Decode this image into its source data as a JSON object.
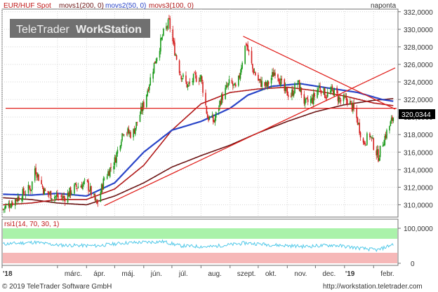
{
  "header": {
    "symbol": "EUR/HUF Spot",
    "indicators": [
      "movs1(200, 0)",
      "movs2(50, 0)",
      "movs3(100, 0)"
    ],
    "period": "naponta",
    "watermark_brand": "TeleTrader",
    "watermark_product": "WorkStation"
  },
  "footer": {
    "copyright": "© 2019 TeleTrader Software GmbH",
    "url": "http://workstation.teletrader.com"
  },
  "colors": {
    "candle_up": "#1a9a1a",
    "candle_down": "#d42020",
    "movs1": "#6b1414",
    "movs2": "#2a45c8",
    "movs3": "#b01818",
    "trendline": "#e0201c",
    "rsi_line": "#4fc8e8",
    "rsi_upper_zone": "#aaf2aa",
    "rsi_lower_zone": "#f6b8b8",
    "grid": "#d6d6d6",
    "frame": "#707070",
    "header_text": "#c01818",
    "price_label_bg": "#000000"
  },
  "chart_data": {
    "type": "candlestick",
    "x_ticks": [
      "'18",
      "márc.",
      "ápr.",
      "máj.",
      "jún.",
      "júl.",
      "aug.",
      "szept.",
      "okt.",
      "nov.",
      "dec.",
      "'19",
      "febr."
    ],
    "y_ticks": [
      "310,0000",
      "312,0000",
      "314,0000",
      "316,0000",
      "318,0000",
      "320,0000",
      "322,0000",
      "324,0000",
      "326,0000",
      "328,0000",
      "330,0000",
      "332,0000"
    ],
    "ylim": [
      308.6,
      332.3
    ],
    "last_price_label": "320,0344",
    "last_price": 320.03,
    "horizontal_line": 321.0,
    "close_anchors": [
      [
        "2018-01-02",
        309.5
      ],
      [
        "2018-01-20",
        311.0
      ],
      [
        "2018-02-01",
        312.0
      ],
      [
        "2018-02-05",
        314.2
      ],
      [
        "2018-02-15",
        311.5
      ],
      [
        "2018-02-25",
        311.0
      ],
      [
        "2018-03-08",
        310.8
      ],
      [
        "2018-03-20",
        312.0
      ],
      [
        "2018-04-01",
        312.5
      ],
      [
        "2018-04-12",
        310.0
      ],
      [
        "2018-04-20",
        313.0
      ],
      [
        "2018-05-01",
        315.0
      ],
      [
        "2018-05-10",
        318.5
      ],
      [
        "2018-05-20",
        318.0
      ],
      [
        "2018-06-01",
        321.5
      ],
      [
        "2018-06-12",
        326.0
      ],
      [
        "2018-06-22",
        329.5
      ],
      [
        "2018-06-28",
        330.8
      ],
      [
        "2018-07-03",
        328.0
      ],
      [
        "2018-07-10",
        325.0
      ],
      [
        "2018-07-18",
        323.5
      ],
      [
        "2018-07-25",
        324.5
      ],
      [
        "2018-08-01",
        324.5
      ],
      [
        "2018-08-08",
        320.0
      ],
      [
        "2018-08-15",
        319.5
      ],
      [
        "2018-08-22",
        322.0
      ],
      [
        "2018-09-01",
        324.0
      ],
      [
        "2018-09-08",
        323.0
      ],
      [
        "2018-09-14",
        326.5
      ],
      [
        "2018-09-18",
        328.5
      ],
      [
        "2018-09-25",
        325.5
      ],
      [
        "2018-10-02",
        324.0
      ],
      [
        "2018-10-10",
        323.5
      ],
      [
        "2018-10-20",
        325.5
      ],
      [
        "2018-10-28",
        323.0
      ],
      [
        "2018-11-05",
        322.5
      ],
      [
        "2018-11-12",
        324.0
      ],
      [
        "2018-11-20",
        321.5
      ],
      [
        "2018-11-28",
        322.0
      ],
      [
        "2018-12-05",
        323.5
      ],
      [
        "2018-12-12",
        322.5
      ],
      [
        "2018-12-20",
        323.0
      ],
      [
        "2018-12-28",
        321.8
      ],
      [
        "2019-01-04",
        322.0
      ],
      [
        "2019-01-10",
        321.0
      ],
      [
        "2019-01-15",
        319.5
      ],
      [
        "2019-01-21",
        317.0
      ],
      [
        "2019-01-28",
        318.0
      ],
      [
        "2019-02-02",
        316.5
      ],
      [
        "2019-02-06",
        315.5
      ],
      [
        "2019-02-12",
        317.5
      ],
      [
        "2019-02-18",
        319.0
      ],
      [
        "2019-02-22",
        320.0
      ]
    ],
    "movs1_anchors": [
      [
        "2018-01-02",
        310.8
      ],
      [
        "2018-02-01",
        310.6
      ],
      [
        "2018-03-01",
        310.2
      ],
      [
        "2018-04-01",
        310.0
      ],
      [
        "2018-05-01",
        311.0
      ],
      [
        "2018-06-01",
        312.5
      ],
      [
        "2018-07-01",
        314.3
      ],
      [
        "2018-08-01",
        315.6
      ],
      [
        "2018-09-01",
        316.8
      ],
      [
        "2018-10-01",
        318.2
      ],
      [
        "2018-11-01",
        319.5
      ],
      [
        "2018-12-01",
        320.6
      ],
      [
        "2019-01-01",
        321.4
      ],
      [
        "2019-02-01",
        321.9
      ],
      [
        "2019-02-22",
        322.1
      ]
    ],
    "movs2_anchors": [
      [
        "2018-01-02",
        311.2
      ],
      [
        "2018-02-01",
        311.1
      ],
      [
        "2018-03-01",
        311.3
      ],
      [
        "2018-04-01",
        311.0
      ],
      [
        "2018-05-01",
        312.5
      ],
      [
        "2018-06-01",
        316.0
      ],
      [
        "2018-07-01",
        318.5
      ],
      [
        "2018-08-01",
        319.5
      ],
      [
        "2018-09-01",
        321.0
      ],
      [
        "2018-09-20",
        322.5
      ],
      [
        "2018-10-15",
        323.5
      ],
      [
        "2018-11-15",
        323.8
      ],
      [
        "2018-12-15",
        323.3
      ],
      [
        "2019-01-15",
        322.8
      ],
      [
        "2019-02-10",
        322.0
      ],
      [
        "2019-02-22",
        321.8
      ]
    ],
    "movs3_anchors": [
      [
        "2018-01-02",
        310.0
      ],
      [
        "2018-02-01",
        310.2
      ],
      [
        "2018-03-01",
        310.6
      ],
      [
        "2018-04-01",
        310.6
      ],
      [
        "2018-05-01",
        311.8
      ],
      [
        "2018-06-01",
        314.5
      ],
      [
        "2018-07-01",
        318.5
      ],
      [
        "2018-08-01",
        321.5
      ],
      [
        "2018-09-01",
        322.8
      ],
      [
        "2018-10-01",
        323.2
      ],
      [
        "2018-11-01",
        323.4
      ],
      [
        "2018-12-01",
        323.0
      ],
      [
        "2019-01-01",
        322.4
      ],
      [
        "2019-02-01",
        321.6
      ],
      [
        "2019-02-22",
        321.3
      ]
    ],
    "trendlines": [
      [
        [
          "2018-09-15",
          329.2
        ],
        [
          "2019-02-24",
          320.9
        ]
      ],
      [
        [
          "2018-04-20",
          309.9
        ],
        [
          "2019-02-24",
          325.6
        ]
      ]
    ],
    "rsi": {
      "label": "rsi1(14, 70, 30, 1)",
      "ylim": [
        0,
        100
      ],
      "upper": 70,
      "lower": 30,
      "y_ticks": [
        "100,0000",
        "0"
      ],
      "anchors": [
        [
          "2018-01-02",
          55
        ],
        [
          "2018-02-05",
          60
        ],
        [
          "2018-03-01",
          52
        ],
        [
          "2018-04-12",
          50
        ],
        [
          "2018-05-10",
          58
        ],
        [
          "2018-06-22",
          62
        ],
        [
          "2018-07-10",
          50
        ],
        [
          "2018-08-10",
          47
        ],
        [
          "2018-09-18",
          58
        ],
        [
          "2018-10-20",
          52
        ],
        [
          "2018-11-20",
          48
        ],
        [
          "2018-12-20",
          52
        ],
        [
          "2019-01-21",
          42
        ],
        [
          "2019-02-06",
          38
        ],
        [
          "2019-02-22",
          55
        ]
      ]
    }
  }
}
